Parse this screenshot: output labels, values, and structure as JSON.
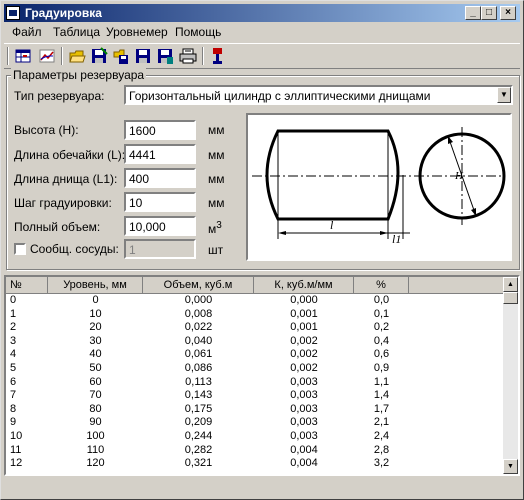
{
  "window": {
    "title": "Градуировка",
    "min": "_",
    "max": "□",
    "close": "×"
  },
  "menu": [
    "Файл",
    "Таблица",
    "Уровнемер",
    "Помощь"
  ],
  "toolbar_icons": [
    "table-icon",
    "chart-icon",
    "open-icon",
    "save-icon",
    "save-as-icon",
    "export-icon",
    "save-alt-icon",
    "print-icon",
    "exit-icon"
  ],
  "params": {
    "group_title": "Параметры резервуара",
    "tank_type_label": "Тип резервуара:",
    "tank_type_value": "Горизонтальный цилиндр с эллиптическими днищами",
    "height_label": "Высота (H):",
    "height_value": "1600",
    "height_unit": "мм",
    "shell_label": "Длина обечайки (L):",
    "shell_value": "4441",
    "shell_unit": "мм",
    "bottom_label": "Длина днища (L1):",
    "bottom_value": "400",
    "bottom_unit": "мм",
    "step_label": "Шаг градуировки:",
    "step_value": "10",
    "step_unit": "мм",
    "volume_label": "Полный объем:",
    "volume_value": "10,000",
    "volume_unit": "м",
    "volume_unit_sup": "3",
    "linked_label": "Сообщ. сосуды:",
    "linked_value": "1",
    "linked_unit": "шт",
    "linked_checked": false
  },
  "diagram": {
    "label_l": "l",
    "label_l1": "l1",
    "label_h": "H"
  },
  "table": {
    "columns": [
      "№",
      "Уровень, мм",
      "Объем, куб.м",
      "К, куб.м/мм",
      "%"
    ],
    "rows": [
      [
        "0",
        "0",
        "0,000",
        "0,000",
        "0,0"
      ],
      [
        "1",
        "10",
        "0,008",
        "0,001",
        "0,1"
      ],
      [
        "2",
        "20",
        "0,022",
        "0,001",
        "0,2"
      ],
      [
        "3",
        "30",
        "0,040",
        "0,002",
        "0,4"
      ],
      [
        "4",
        "40",
        "0,061",
        "0,002",
        "0,6"
      ],
      [
        "5",
        "50",
        "0,086",
        "0,002",
        "0,9"
      ],
      [
        "6",
        "60",
        "0,113",
        "0,003",
        "1,1"
      ],
      [
        "7",
        "70",
        "0,143",
        "0,003",
        "1,4"
      ],
      [
        "8",
        "80",
        "0,175",
        "0,003",
        "1,7"
      ],
      [
        "9",
        "90",
        "0,209",
        "0,003",
        "2,1"
      ],
      [
        "10",
        "100",
        "0,244",
        "0,003",
        "2,4"
      ],
      [
        "11",
        "110",
        "0,282",
        "0,004",
        "2,8"
      ],
      [
        "12",
        "120",
        "0,321",
        "0,004",
        "3,2"
      ]
    ]
  }
}
